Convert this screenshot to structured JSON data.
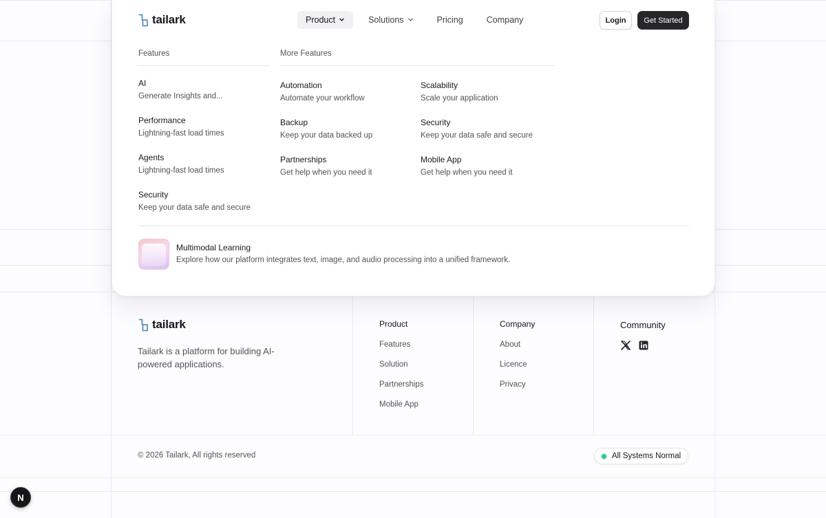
{
  "brand": {
    "name": "tailark",
    "icon": "tailark-logo-icon"
  },
  "nav": {
    "items": [
      {
        "label": "Product",
        "has_dropdown": true,
        "active": true
      },
      {
        "label": "Solutions",
        "has_dropdown": true,
        "active": false
      },
      {
        "label": "Pricing",
        "has_dropdown": false,
        "active": false
      },
      {
        "label": "Company",
        "has_dropdown": false,
        "active": false
      }
    ],
    "login_label": "Login",
    "cta_label": "Get Started"
  },
  "dropdown": {
    "features_heading": "Features",
    "features": [
      {
        "title": "AI",
        "desc": "Generate Insights and..."
      },
      {
        "title": "Performance",
        "desc": "Lightning-fast load times"
      },
      {
        "title": "Agents",
        "desc": "Lightning-fast load times"
      },
      {
        "title": "Security",
        "desc": "Keep your data safe and secure"
      }
    ],
    "more_heading": "More Features",
    "more": [
      {
        "title": "Automation",
        "desc": "Automate your workflow"
      },
      {
        "title": "Scalability",
        "desc": "Scale your application"
      },
      {
        "title": "Backup",
        "desc": "Keep your data backed up"
      },
      {
        "title": "Security",
        "desc": "Keep your data safe and secure"
      },
      {
        "title": "Partnerships",
        "desc": "Get help when you need it"
      },
      {
        "title": "Mobile App",
        "desc": "Get help when you need it"
      }
    ],
    "promo": {
      "title": "Multimodal Learning",
      "desc": "Explore how our platform integrates text, image, and audio processing into a unified framework."
    }
  },
  "footer": {
    "tagline": "Tailark is a platform for building AI-powered applications.",
    "product": {
      "title": "Product",
      "links": [
        "Features",
        "Solution",
        "Partnerships",
        "Mobile App"
      ]
    },
    "company": {
      "title": "Company",
      "links": [
        "About",
        "Licence",
        "Privacy"
      ]
    },
    "community": {
      "title": "Community",
      "icons": [
        "x-twitter-icon",
        "linkedin-icon"
      ]
    },
    "copyright": "© 2026 Tailark, All rights reserved",
    "status": "All Systems Normal"
  },
  "dev_badge": {
    "letter": "N"
  },
  "colors": {
    "accent_dark": "#27272a",
    "logo_blue": "#5a8fb8",
    "status_green": "#34c38f"
  }
}
